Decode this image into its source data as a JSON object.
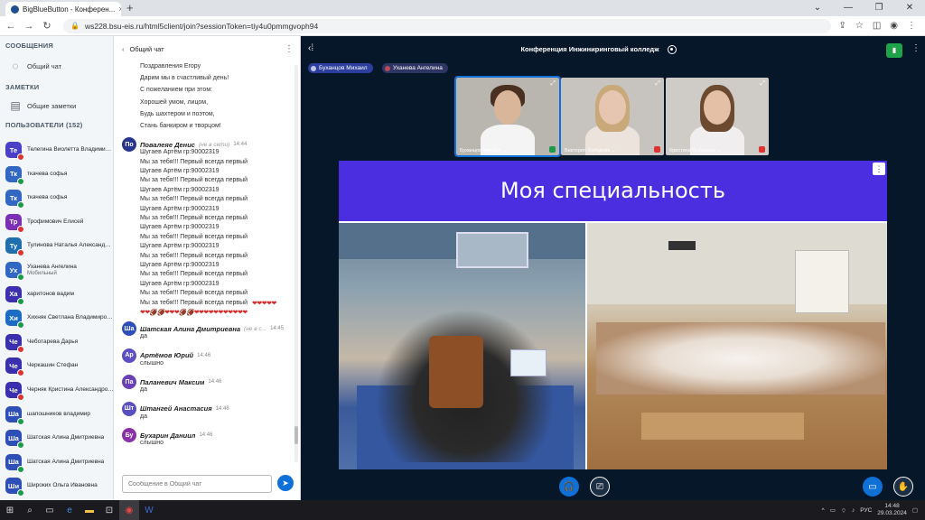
{
  "browser": {
    "tab_title": "BigBlueButton - Конферен...",
    "tab_close": "×",
    "new_tab": "+",
    "url": "ws228.bsu-eis.ru/html5client/join?sessionToken=tiy4u0pmmgvoph94",
    "window_controls": [
      "⌄",
      "—",
      "❐",
      "✕"
    ]
  },
  "sidebar": {
    "messages_title": "СООБЩЕНИЯ",
    "public_chat": "Общий чат",
    "notes_title": "ЗАМЕТКИ",
    "shared_notes": "Общие заметки",
    "users_title": "ПОЛЬЗОВАТЕЛИ (152)",
    "users": [
      {
        "initials": "Те",
        "name": "Телегина Виолетта Владимиро...",
        "color": "#4a40c8",
        "mic": "#d33"
      },
      {
        "initials": "Тк",
        "name": "ткачева софья",
        "color": "#3267c4",
        "mic": "#1a9a4a"
      },
      {
        "initials": "Тк",
        "name": "ткачева софья",
        "color": "#3267c4",
        "mic": "#1a9a4a"
      },
      {
        "initials": "Тр",
        "name": "Трофимович Елисей",
        "color": "#7b2fb5",
        "mic": "#d33"
      },
      {
        "initials": "Ту",
        "name": "Тулинова Наталья Александро...",
        "color": "#1f6fb0",
        "mic": "#d33"
      },
      {
        "initials": "Ух",
        "name": "Уханева Ангелина",
        "sub": "Мобильный",
        "color": "#3067c4",
        "mic": "#1a9a4a"
      },
      {
        "initials": "Ха",
        "name": "харитонов вадим",
        "color": "#3d2fae",
        "mic": "#1a9a4a"
      },
      {
        "initials": "Хи",
        "name": "Хихняк Светлана Владимиров...",
        "color": "#1b6cc4",
        "mic": "#1a9a4a"
      },
      {
        "initials": "Че",
        "name": "Чеботарева Дарья",
        "color": "#3a2fae",
        "mic": "#d33"
      },
      {
        "initials": "Че",
        "name": "Черкашин Стефан",
        "color": "#3a2fae",
        "mic": "#d33"
      },
      {
        "initials": "Че",
        "name": "Черняк Кристина Александров...",
        "color": "#3a2fae",
        "mic": "#d33"
      },
      {
        "initials": "Ша",
        "name": "шапошников владимир",
        "color": "#2e4fb8",
        "mic": "#1a9a4a"
      },
      {
        "initials": "Ша",
        "name": "Шатская Алина Дмитриевна",
        "color": "#2e4fb8",
        "mic": "#1a9a4a"
      },
      {
        "initials": "Ша",
        "name": "Шатская Алина Дмитриевна",
        "color": "#2e4fb8",
        "mic": "#1a9a4a"
      },
      {
        "initials": "Ши",
        "name": "Широких Ольга Ивановна",
        "color": "#2e4fb8",
        "mic": "#1a9a4a"
      }
    ]
  },
  "chat": {
    "header": "Общий чат",
    "poem": [
      "Поздравления Егору",
      "Дарим мы в счастливый день!",
      "С пожеланием при этом:",
      "Хорошей умом, лицом,",
      "Будь шахтером и поэтом,",
      "Стань банкиром и творцом!"
    ],
    "msg1": {
      "initials": "По",
      "name": "Повалеяе Денис",
      "status": "(не в сети)",
      "time": "14:44",
      "color": "#26358f"
    },
    "msg1_lines": [
      "Шугаев Артём гр:90002319",
      "Мы за тебя!!! Первый всегда первый",
      "Шугаев Артём гр:90002319",
      "Мы за тебя!!! Первый всегда первый",
      "Шугаев Артём гр:90002319",
      "Мы за тебя!!! Первый всегда первый",
      "Шугаев Артём гр:90002319",
      "Мы за тебя!!! Первый всегда первый",
      "Шугаев Артём гр:90002319",
      "Мы за тебя!!! Первый всегда первый",
      "Шугаев Артём гр:90002319",
      "Мы за тебя!!! Первый всегда первый",
      "Шугаев Артём гр:90002319",
      "Мы за тебя!!! Первый всегда первый",
      "Шугаев Артём гр:90002319",
      "Мы за тебя!!! Первый всегда первый"
    ],
    "msg1_last": "Мы за тебя!!! Первый всегда первый",
    "hearts1": "❤❤❤❤❤",
    "hearts2": "❤❤🏈🏈❤❤❤🏈🏈❤❤❤❤❤❤❤❤❤❤❤",
    "messages": [
      {
        "initials": "Ша",
        "name": "Шатская Алина Дмитриевна",
        "status": "(не в с...",
        "time": "14:45",
        "text": "да",
        "color": "#2e4fb8"
      },
      {
        "initials": "Ар",
        "name": "Артёмов Юрий",
        "status": "",
        "time": "14:46",
        "text": "слышно",
        "color": "#5a4fc0"
      },
      {
        "initials": "Па",
        "name": "Паланевич Максим",
        "status": "",
        "time": "14:46",
        "text": "да",
        "color": "#6a3fb8"
      },
      {
        "initials": "Шт",
        "name": "Штангей Анастасия",
        "status": "",
        "time": "14:46",
        "text": "да",
        "color": "#5a4fc0"
      },
      {
        "initials": "Бу",
        "name": "Бухарин Даниил",
        "status": "",
        "time": "14:46",
        "text": "слышно",
        "color": "#8a2fa8"
      }
    ],
    "input_placeholder": "Сообщение в Общий чат"
  },
  "main": {
    "title": "Конференция Инжиниринговый колледж",
    "talkers": [
      {
        "name": "Буханцов Михаил",
        "color": "#2c3f9e"
      },
      {
        "name": "Уханева Ангелина",
        "color": "#2f3562"
      }
    ],
    "videos": [
      {
        "name": "Буханцов Михаил ⌄",
        "mic": "#1a9a4a",
        "skin": "#d9b59a",
        "hair": "#4a3020",
        "shirt": "#f4f4f4",
        "bg": "#b9b6b0"
      },
      {
        "name": "Виктория Холодова ⌄",
        "mic": "#d33",
        "skin": "#e6c6b0",
        "hair": "#c9a87a",
        "shirt": "#ece4dc",
        "bg": "#c7c4c0"
      },
      {
        "name": "Кристина Выродова ⌄",
        "mic": "#d33",
        "skin": "#e3c0a6",
        "hair": "#6b4a30",
        "shirt": "#f0eeee",
        "bg": "#cfcbc6"
      }
    ],
    "slide_title": "Моя специальность"
  },
  "taskbar": {
    "lang": "РУС",
    "time": "14:48",
    "date": "29.03.2024"
  },
  "colors": {
    "accent": "#0f70d7",
    "slide_band": "#4b2ee0",
    "main_bg": "#06172a"
  }
}
